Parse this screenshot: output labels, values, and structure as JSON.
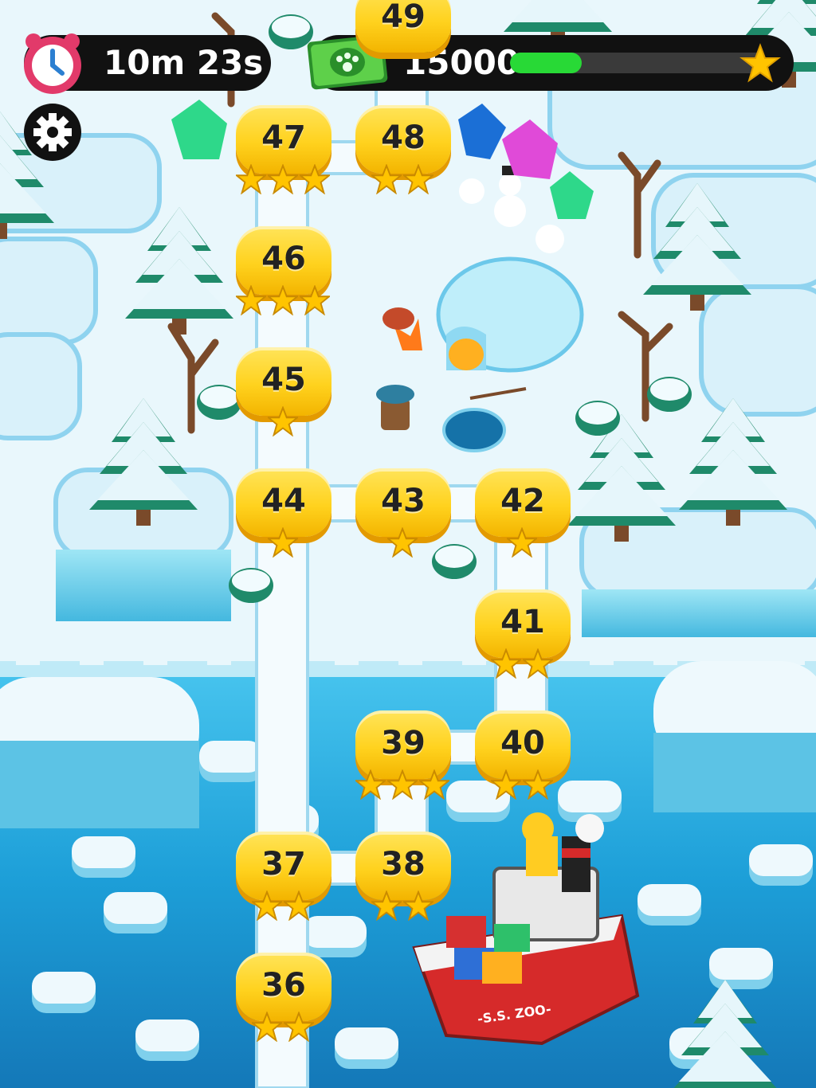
{
  "hud": {
    "timer": "10m 23s",
    "currency": "15000",
    "progress": 0.28
  },
  "icons": {
    "timer": "alarm-clock-icon",
    "currency": "paw-banknote-icon",
    "progress_end": "star-icon",
    "settings": "gear-icon"
  },
  "boat": {
    "label": "-S.S. ZOO-"
  },
  "levels": [
    {
      "number": "36",
      "stars": 2
    },
    {
      "number": "37",
      "stars": 2
    },
    {
      "number": "38",
      "stars": 2
    },
    {
      "number": "39",
      "stars": 3
    },
    {
      "number": "40",
      "stars": 2
    },
    {
      "number": "41",
      "stars": 2
    },
    {
      "number": "42",
      "stars": 1
    },
    {
      "number": "43",
      "stars": 1
    },
    {
      "number": "44",
      "stars": 1
    },
    {
      "number": "45",
      "stars": 1
    },
    {
      "number": "46",
      "stars": 3
    },
    {
      "number": "47",
      "stars": 3
    },
    {
      "number": "48",
      "stars": 2
    },
    {
      "number": "49",
      "stars": 0
    }
  ],
  "colors": {
    "level_fill": "#ffd21e",
    "progress_fill": "#28d936",
    "star": "#ffc400",
    "water": "#1f9ed6",
    "snow": "#eaf8fd"
  }
}
